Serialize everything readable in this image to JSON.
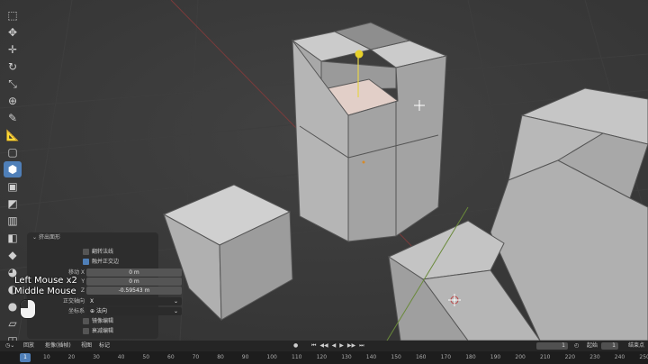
{
  "toolbar": {
    "tools": [
      {
        "name": "select-icon",
        "glyph": "⬚"
      },
      {
        "name": "cursor-icon",
        "glyph": "✥"
      },
      {
        "name": "move-icon",
        "glyph": "✛"
      },
      {
        "name": "rotate-icon",
        "glyph": "↻"
      },
      {
        "name": "scale-icon",
        "glyph": "⤡"
      },
      {
        "name": "transform-icon",
        "glyph": "⊕"
      },
      {
        "name": "annotate-icon",
        "glyph": "✎"
      },
      {
        "name": "measure-icon",
        "glyph": "📐"
      },
      {
        "name": "add-cube-icon",
        "glyph": "▢"
      },
      {
        "name": "extrude-icon",
        "glyph": "⬢"
      },
      {
        "name": "inset-icon",
        "glyph": "▣"
      },
      {
        "name": "bevel-icon",
        "glyph": "◩"
      },
      {
        "name": "loop-cut-icon",
        "glyph": "▥"
      },
      {
        "name": "knife-icon",
        "glyph": "◧"
      },
      {
        "name": "poly-build-icon",
        "glyph": "◆"
      },
      {
        "name": "spin-icon",
        "glyph": "◕"
      },
      {
        "name": "smooth-icon",
        "glyph": "◐"
      },
      {
        "name": "shrink-icon",
        "glyph": "●"
      },
      {
        "name": "shear-icon",
        "glyph": "▱"
      },
      {
        "name": "rip-icon",
        "glyph": "◫"
      }
    ],
    "active_index": 9
  },
  "redo_panel": {
    "title": "挤出面形",
    "flip_normals": "翻转法线",
    "dissolve_orthogonal": "融并正交边",
    "move_label_x": "移动 X",
    "move_label_y": "Y",
    "move_label_z": "Z",
    "move_x": "0 m",
    "move_y": "0 m",
    "move_z": "-0.59543 m",
    "orientation_label": "正交轴向",
    "orientation_value": "X",
    "coord_label": "坐标系",
    "coord_value": "法向",
    "mirror_edit": "镜像编辑",
    "proportional_edit": "衰减编辑"
  },
  "hint": {
    "line1": "Left Mouse x2",
    "line2": "Middle Mouse"
  },
  "timeline": {
    "menu_playback": "回放",
    "menu_keying": "抠像(插帧)",
    "menu_view": "视图",
    "menu_marker": "标记",
    "current_frame": "1",
    "start_label": "起始",
    "start_frame": "1",
    "end_label": "结束点",
    "end_frame": "250",
    "playback_buttons": [
      "⏮",
      "◀◀",
      "◀",
      "▶",
      "▶▶",
      "⏭"
    ]
  },
  "ruler": {
    "ticks": [
      "1",
      "10",
      "20",
      "30",
      "40",
      "50",
      "60",
      "70",
      "80",
      "90",
      "100",
      "110",
      "120",
      "130",
      "140",
      "150",
      "160",
      "170",
      "180",
      "190",
      "200",
      "210",
      "220",
      "230",
      "240",
      "250"
    ]
  }
}
